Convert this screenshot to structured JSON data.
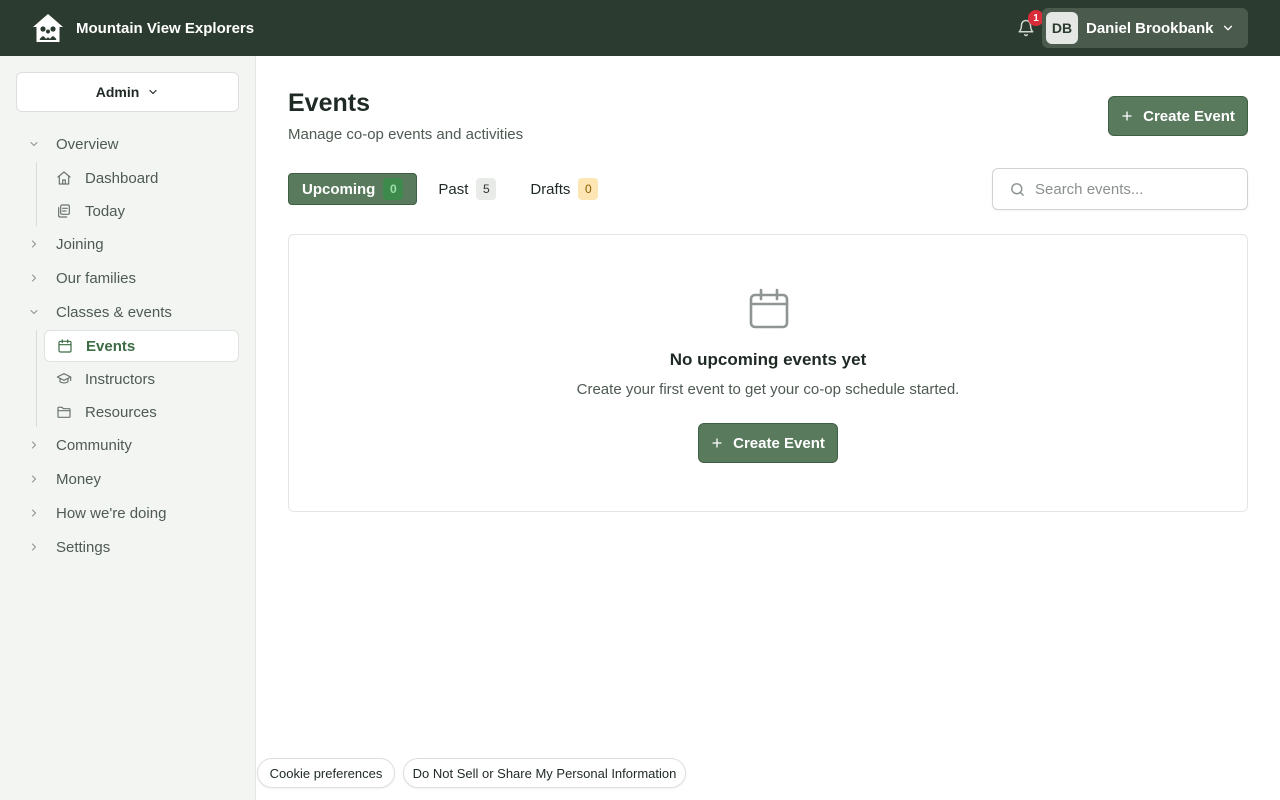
{
  "header": {
    "brand_name": "Mountain View Explorers",
    "logo_icon": "house-family-icon",
    "notifications_count": "1",
    "user": {
      "initials": "DB",
      "name": "Daniel Brookbank"
    }
  },
  "sidebar": {
    "role_label": "Admin",
    "groups": {
      "overview": {
        "label": "Overview",
        "expanded": true
      },
      "joining": {
        "label": "Joining",
        "expanded": false
      },
      "families": {
        "label": "Our families",
        "expanded": false
      },
      "classes": {
        "label": "Classes & events",
        "expanded": true
      },
      "community": {
        "label": "Community",
        "expanded": false
      },
      "money": {
        "label": "Money",
        "expanded": false
      },
      "doing": {
        "label": "How we're doing",
        "expanded": false
      },
      "settings": {
        "label": "Settings",
        "expanded": false
      }
    },
    "items": {
      "dashboard": {
        "label": "Dashboard",
        "icon": "home-icon"
      },
      "today": {
        "label": "Today",
        "icon": "calendar-clipboard-icon"
      },
      "events": {
        "label": "Events",
        "icon": "calendar-icon",
        "active": true
      },
      "instructors": {
        "label": "Instructors",
        "icon": "graduation-cap-icon"
      },
      "resources": {
        "label": "Resources",
        "icon": "folder-icon"
      }
    }
  },
  "page": {
    "title": "Events",
    "subtitle": "Manage co-op events and activities",
    "create_label": "Create Event"
  },
  "tabs": [
    {
      "label": "Upcoming",
      "count": "0",
      "active": true
    },
    {
      "label": "Past",
      "count": "5",
      "active": false
    },
    {
      "label": "Drafts",
      "count": "0",
      "active": false
    }
  ],
  "search": {
    "placeholder": "Search events..."
  },
  "empty_state": {
    "icon": "calendar-icon",
    "title": "No upcoming events yet",
    "message": "Create your first event to get your co-op schedule started.",
    "button_label": "Create Event"
  },
  "footer": {
    "cookie_label": "Cookie preferences",
    "privacy_label": "Do Not Sell or Share My Personal Information"
  },
  "colors": {
    "header_bg": "#2c3b2f",
    "primary": "#5a7a5e",
    "active_text": "#3d6b46",
    "badge_red": "#d92d3a"
  }
}
